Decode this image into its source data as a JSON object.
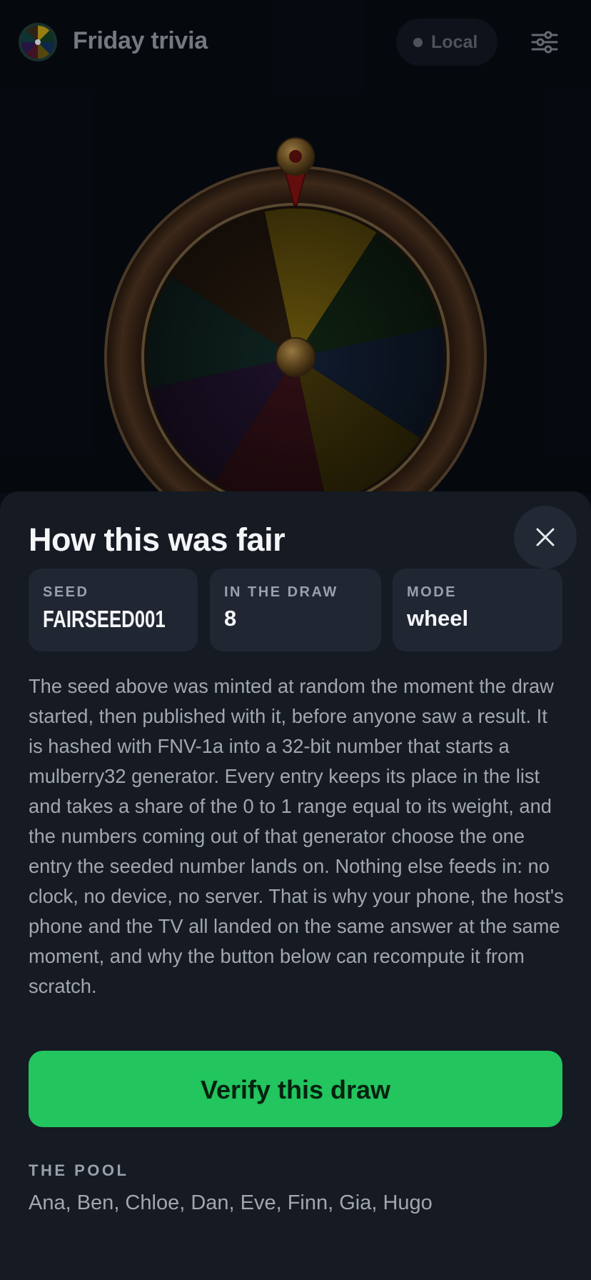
{
  "header": {
    "title": "Friday trivia",
    "status_label": "Local"
  },
  "wheel": {
    "segments": [
      "#c9a514",
      "#0f3d23",
      "#11305e",
      "#6e5b0c",
      "#55142a",
      "#2e1a55",
      "#0f4040",
      "#3c2818"
    ]
  },
  "sheet": {
    "title": "How this was fair",
    "cards": [
      {
        "label": "SEED",
        "value": "FAIRSEED001"
      },
      {
        "label": "IN THE DRAW",
        "value": "8"
      },
      {
        "label": "MODE",
        "value": "wheel"
      }
    ],
    "explanation": "The seed above was minted at random the moment the draw started, then published with it, before anyone saw a result. It is hashed with FNV-1a into a 32-bit number that starts a mulberry32 generator. Every entry keeps its place in the list and takes a share of the 0 to 1 range equal to its weight, and the numbers coming out of that generator choose the one entry the seeded number lands on. Nothing else feeds in: no clock, no device, no server. That is why your phone, the host's phone and the TV all landed on the same answer at the same moment, and why the button below can recompute it from scratch.",
    "verify_label": "Verify this draw",
    "pool_label": "THE POOL",
    "pool_names": "Ana, Ben, Chloe, Dan, Eve, Finn, Gia, Hugo"
  },
  "colors": {
    "accent": "#22c55e",
    "background": "#070b12",
    "sheet": "#151a23"
  }
}
